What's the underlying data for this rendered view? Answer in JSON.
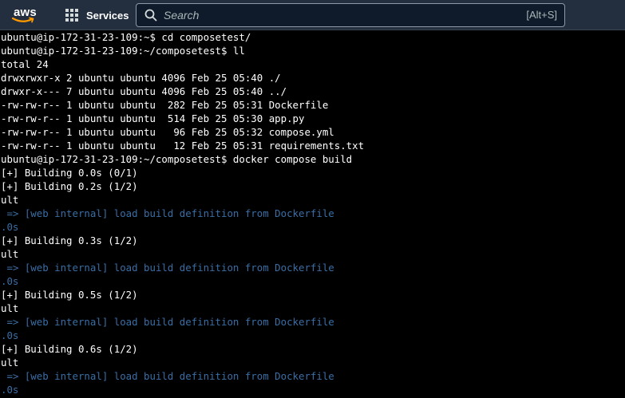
{
  "header": {
    "logo_text": "aws",
    "services_label": "Services",
    "search_placeholder": "Search",
    "search_shortcut": "[Alt+S]"
  },
  "colors": {
    "header_bg": "#232f3e",
    "terminal_bg": "#000000",
    "terminal_fg": "#ffffff",
    "dim_blue": "#3a6ea5",
    "aws_orange": "#ff9900"
  },
  "terminal": {
    "lines": [
      "ubuntu@ip-172-31-23-109:~$ cd composetest/",
      "ubuntu@ip-172-31-23-109:~/composetest$ ll",
      "total 24",
      "drwxrwxr-x 2 ubuntu ubuntu 4096 Feb 25 05:40 ./",
      "drwxr-x--- 7 ubuntu ubuntu 4096 Feb 25 05:40 ../",
      "-rw-rw-r-- 1 ubuntu ubuntu  282 Feb 25 05:31 Dockerfile",
      "-rw-rw-r-- 1 ubuntu ubuntu  514 Feb 25 05:30 app.py",
      "-rw-rw-r-- 1 ubuntu ubuntu   96 Feb 25 05:32 compose.yml",
      "-rw-rw-r-- 1 ubuntu ubuntu   12 Feb 25 05:31 requirements.txt",
      "ubuntu@ip-172-31-23-109:~/composetest$ docker compose build",
      "[+] Building 0.0s (0/1)",
      "[+] Building 0.2s (1/2)",
      "ult",
      " => [web internal] load build definition from Dockerfile",
      ".0s",
      "[+] Building 0.3s (1/2)",
      "ult",
      " => [web internal] load build definition from Dockerfile",
      ".0s",
      "[+] Building 0.5s (1/2)",
      "ult",
      " => [web internal] load build definition from Dockerfile",
      ".0s",
      "[+] Building 0.6s (1/2)",
      "ult",
      " => [web internal] load build definition from Dockerfile",
      ".0s"
    ]
  }
}
